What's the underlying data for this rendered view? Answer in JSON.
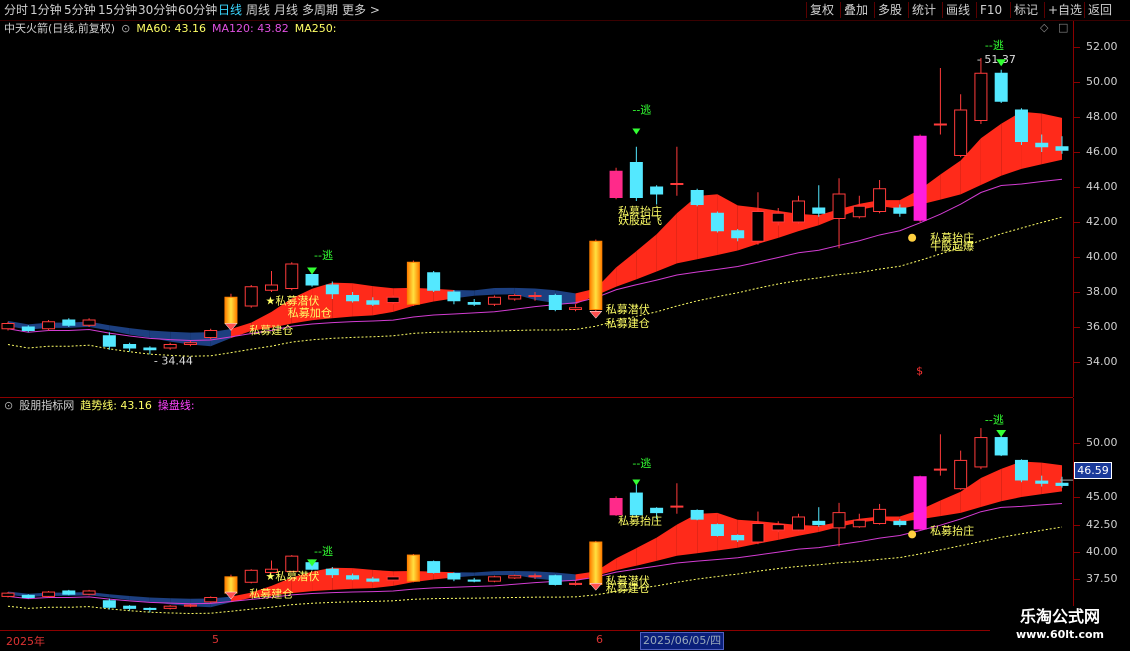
{
  "toolbar": {
    "left_items": [
      "分时",
      "1分钟",
      "5分钟",
      "15分钟",
      "30分钟",
      "60分钟",
      "日线",
      "周线",
      "月线",
      "多周期",
      "更多"
    ],
    "active": "日线",
    "right_items": [
      "复权",
      "叠加",
      "多股",
      "统计",
      "画线",
      "F10",
      "标记",
      "+自选",
      "返回"
    ]
  },
  "main_panel": {
    "stock_name": "中天火箭(日线,前复权)",
    "ma60": "MA60: 43.16",
    "ma120": "MA120: 43.82",
    "ma250": "MA250:",
    "y_ticks": [
      "52.00",
      "50.00",
      "48.00",
      "46.00",
      "44.00",
      "42.00",
      "40.00",
      "38.00",
      "36.00",
      "34.00"
    ],
    "high_label": "51.37",
    "low_label": "34.44",
    "signals": {
      "escape": "--逃",
      "pe1": "★私募潜伏",
      "pe2": "私募加仓",
      "pe3": "私募建仓",
      "pe4": "私募潜伏",
      "pe5": "私募抬庄",
      "pe6": "妖股起飞",
      "pe7": "私募建仓",
      "pe8": "私募抬庄",
      "pe9": "牛股起爆",
      "dollar": "$"
    }
  },
  "sub_panel": {
    "indicator_name": "股朋指标网",
    "trend_line": "趋势线: 43.16",
    "operation_line": "操盘线:",
    "y_ticks": [
      "50.00",
      "45.00",
      "42.50",
      "40.00",
      "37.50"
    ],
    "current_price": "46.59"
  },
  "date_axis": {
    "labels": [
      "2025年",
      "5",
      "6"
    ],
    "selected_date": "2025/06/05/四"
  },
  "watermark": {
    "line1": "乐淘公式网",
    "line2": "www.60lt.com"
  },
  "colors": {
    "up": "#ff3b3b",
    "down": "#54e8ff",
    "ribbon_up": "#ff2a1a",
    "ribbon_down": "#1c3f80",
    "ma120": "#d23cd2",
    "ma250": "#ffff66",
    "magenta": "#ff1edc",
    "gold": "#ffb400",
    "axis": "#8b0000"
  },
  "chart_data": {
    "type": "candlestick",
    "y_range_main": [
      32.6,
      53.0
    ],
    "candles": [
      {
        "o": 35.9,
        "c": 36.2,
        "h": 36.3,
        "l": 35.8
      },
      {
        "o": 36.0,
        "c": 35.8,
        "h": 36.1,
        "l": 35.7
      },
      {
        "o": 35.9,
        "c": 36.3,
        "h": 36.4,
        "l": 35.8
      },
      {
        "o": 36.4,
        "c": 36.1,
        "h": 36.5,
        "l": 36.0
      },
      {
        "o": 36.1,
        "c": 36.4,
        "h": 36.5,
        "l": 36.0
      },
      {
        "o": 35.5,
        "c": 34.9,
        "h": 35.7,
        "l": 34.7
      },
      {
        "o": 35.0,
        "c": 34.8,
        "h": 35.1,
        "l": 34.6
      },
      {
        "o": 34.8,
        "c": 34.7,
        "h": 34.9,
        "l": 34.44
      },
      {
        "o": 34.8,
        "c": 35.0,
        "h": 35.1,
        "l": 34.7
      },
      {
        "o": 35.0,
        "c": 35.1,
        "h": 35.2,
        "l": 34.9
      },
      {
        "o": 35.4,
        "c": 35.8,
        "h": 35.9,
        "l": 35.3
      },
      {
        "o": 36.2,
        "c": 37.7,
        "h": 37.9,
        "l": 36.1
      },
      {
        "o": 37.2,
        "c": 38.3,
        "h": 38.4,
        "l": 37.1
      },
      {
        "o": 38.1,
        "c": 38.4,
        "h": 39.2,
        "l": 38.0
      },
      {
        "o": 38.2,
        "c": 39.6,
        "h": 39.7,
        "l": 38.1
      },
      {
        "o": 39.0,
        "c": 38.4,
        "h": 39.3,
        "l": 38.3
      },
      {
        "o": 38.4,
        "c": 37.9,
        "h": 38.6,
        "l": 37.6
      },
      {
        "o": 37.8,
        "c": 37.5,
        "h": 38.0,
        "l": 37.4
      },
      {
        "o": 37.5,
        "c": 37.3,
        "h": 37.7,
        "l": 37.2
      },
      {
        "o": 37.4,
        "c": 37.7,
        "h": 37.8,
        "l": 37.3
      },
      {
        "o": 37.3,
        "c": 39.7,
        "h": 39.8,
        "l": 37.2
      },
      {
        "o": 39.1,
        "c": 38.1,
        "h": 39.2,
        "l": 38.0
      },
      {
        "o": 38.0,
        "c": 37.5,
        "h": 38.1,
        "l": 37.3
      },
      {
        "o": 37.4,
        "c": 37.3,
        "h": 37.6,
        "l": 37.2
      },
      {
        "o": 37.3,
        "c": 37.7,
        "h": 37.8,
        "l": 37.2
      },
      {
        "o": 37.6,
        "c": 37.8,
        "h": 37.9,
        "l": 37.5
      },
      {
        "o": 37.8,
        "c": 37.8,
        "h": 38.0,
        "l": 37.5
      },
      {
        "o": 37.8,
        "c": 37.0,
        "h": 37.9,
        "l": 36.9
      },
      {
        "o": 37.0,
        "c": 37.1,
        "h": 37.3,
        "l": 36.9
      },
      {
        "o": 37.0,
        "c": 40.9,
        "h": 41.0,
        "l": 36.9
      },
      {
        "o": 43.4,
        "c": 44.9,
        "h": 45.1,
        "l": 43.3
      },
      {
        "o": 45.4,
        "c": 43.4,
        "h": 46.3,
        "l": 43.2
      },
      {
        "o": 44.0,
        "c": 43.6,
        "h": 44.1,
        "l": 43.0
      },
      {
        "o": 44.2,
        "c": 44.2,
        "h": 46.3,
        "l": 43.5
      },
      {
        "o": 43.8,
        "c": 43.0,
        "h": 43.9,
        "l": 42.9
      },
      {
        "o": 42.5,
        "c": 41.5,
        "h": 42.6,
        "l": 41.4
      },
      {
        "o": 41.5,
        "c": 41.1,
        "h": 41.6,
        "l": 40.9
      },
      {
        "o": 40.9,
        "c": 42.6,
        "h": 43.7,
        "l": 40.7
      },
      {
        "o": 42.0,
        "c": 42.5,
        "h": 42.8,
        "l": 41.8
      },
      {
        "o": 42.0,
        "c": 43.2,
        "h": 43.5,
        "l": 41.9
      },
      {
        "o": 42.8,
        "c": 42.5,
        "h": 44.1,
        "l": 42.3
      },
      {
        "o": 42.2,
        "c": 43.6,
        "h": 44.5,
        "l": 40.5
      },
      {
        "o": 42.3,
        "c": 42.9,
        "h": 43.5,
        "l": 42.2
      },
      {
        "o": 42.6,
        "c": 43.9,
        "h": 44.4,
        "l": 42.5
      },
      {
        "o": 42.8,
        "c": 42.5,
        "h": 43.0,
        "l": 42.3
      },
      {
        "o": 42.1,
        "c": 46.9,
        "h": 47.0,
        "l": 42.0
      },
      {
        "o": 47.6,
        "c": 47.6,
        "h": 50.8,
        "l": 47.0
      },
      {
        "o": 45.8,
        "c": 48.4,
        "h": 49.3,
        "l": 45.7
      },
      {
        "o": 47.8,
        "c": 50.5,
        "h": 51.37,
        "l": 47.6
      },
      {
        "o": 50.5,
        "c": 48.9,
        "h": 50.7,
        "l": 48.8
      },
      {
        "o": 48.4,
        "c": 46.6,
        "h": 48.5,
        "l": 46.4
      },
      {
        "o": 46.5,
        "c": 46.3,
        "h": 47.0,
        "l": 46.0
      },
      {
        "o": 46.3,
        "c": 46.1,
        "h": 46.9,
        "l": 45.9
      }
    ]
  }
}
